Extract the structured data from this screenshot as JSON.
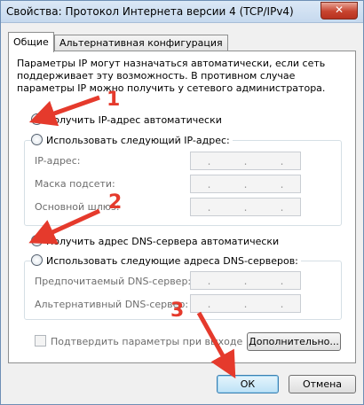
{
  "window": {
    "title": "Свойства: Протокол Интернета версии 4 (TCP/IPv4)",
    "close_glyph": "✕"
  },
  "tabs": [
    {
      "label": "Общие",
      "active": true
    },
    {
      "label": "Альтернативная конфигурация",
      "active": false
    }
  ],
  "description": "Параметры IP могут назначаться автоматически, если сеть поддерживает эту возможность. В противном случае параметры IP можно получить у сетевого администратора.",
  "ip": {
    "auto_label": "Получить IP-адрес автоматически",
    "auto_checked": true,
    "manual_label": "Использовать следующий IP-адрес:",
    "manual_checked": false,
    "fields": [
      {
        "label": "IP-адрес:"
      },
      {
        "label": "Маска подсети:"
      },
      {
        "label": "Основной шлюз:"
      }
    ]
  },
  "dns": {
    "auto_label": "Получить адрес DNS-сервера автоматически",
    "auto_checked": true,
    "manual_label": "Использовать следующие адреса DNS-серверов:",
    "manual_checked": false,
    "fields": [
      {
        "label": "Предпочитаемый DNS-сервер:"
      },
      {
        "label": "Альтернативный DNS-сервер:"
      }
    ]
  },
  "ip_dots": ".",
  "validate_label": "Подтвердить параметры при выходе",
  "buttons": {
    "advanced": "Дополнительно...",
    "ok": "ОК",
    "cancel": "Отмена"
  },
  "annotations": {
    "step1": "1",
    "step2": "2",
    "step3": "3",
    "color": "#e53a2c"
  }
}
